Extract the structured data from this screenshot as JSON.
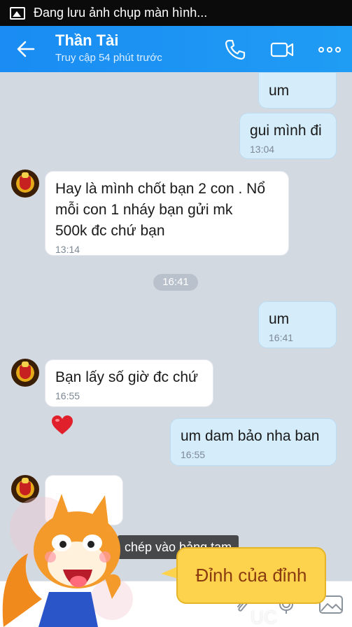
{
  "status_bar": {
    "notification": "Đang lưu ảnh chụp màn hình..."
  },
  "header": {
    "name": "Thần Tài",
    "last_seen": "Truy cập 54 phút trước",
    "accent": "#1a8cf3"
  },
  "messages": [
    {
      "side": "out",
      "text": "um",
      "time": ""
    },
    {
      "side": "out",
      "text": "gui mình đi",
      "time": "13:04"
    },
    {
      "side": "in",
      "lines": [
        "Hay là mình chốt bạn 2 con . Nổ",
        "mỗi con 1 nháy bạn gửi mk",
        "500k đc chứ bạn"
      ],
      "time": "13:14"
    },
    {
      "side": "out",
      "text": "um",
      "time": "16:41"
    },
    {
      "side": "in",
      "text": "Bạn lấy số giờ đc chứ",
      "time": "16:55"
    },
    {
      "side": "out",
      "text": "um dam bảo nha ban",
      "time": "16:55"
    }
  ],
  "divider_time": "16:41",
  "sticker": "heart-sticker",
  "toast": "chép vào bảng tạm",
  "mascot_bubble": "Đỉnh của đỉnh",
  "watermark": "UC Browser",
  "colors": {
    "chat_bg": "#d3d9e1",
    "outgoing_bubble": "#d5ecfb",
    "incoming_bubble": "#ffffff",
    "speech_bubble": "#fdd34d"
  }
}
